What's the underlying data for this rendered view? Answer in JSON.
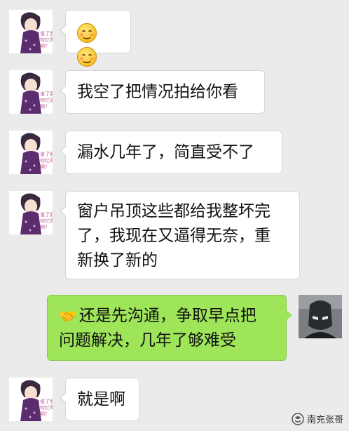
{
  "messages": [
    {
      "side": "left",
      "type": "emoji",
      "emoji_names": [
        "smile-emoji-icon",
        "smile-emoji-icon"
      ]
    },
    {
      "side": "left",
      "type": "text",
      "lines": [
        "我空了把情况拍给你看"
      ]
    },
    {
      "side": "left",
      "type": "text",
      "lines": [
        "漏水几年了，简直受不了"
      ]
    },
    {
      "side": "left",
      "type": "text",
      "lines": [
        "窗户吊顶这些都给我整坏完",
        "了，我现在又逼得无奈，重",
        "新换了新的"
      ]
    },
    {
      "side": "right",
      "type": "text",
      "icon": "handshake-icon",
      "lines": [
        "还是先沟通，争取早点把",
        "问题解决，几年了够难受"
      ]
    },
    {
      "side": "left",
      "type": "text",
      "lines": [
        "就是啊"
      ]
    }
  ],
  "avatar_caption": [
    "谁了我",
    "何忆哥",
    "啊?"
  ],
  "watermark": {
    "text": "南充张哥",
    "icon": "wechat-channel-icon"
  },
  "colors": {
    "background": "#ebebeb",
    "left_bubble": "#ffffff",
    "right_bubble": "#9fe55a"
  }
}
